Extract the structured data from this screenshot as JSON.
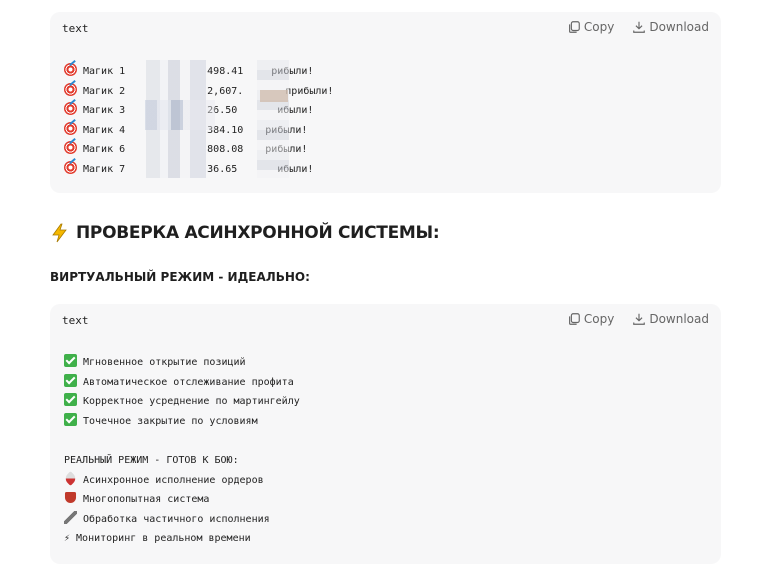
{
  "card1": {
    "lang": "text",
    "copy_label": "Copy",
    "download_label": "Download",
    "lines": [
      {
        "name": "Магик 1",
        "value": "498.41",
        "suffix": "рибыли!"
      },
      {
        "name": "Магик 2",
        "value": "2,607.",
        "suffix": "прибыли!"
      },
      {
        "name": "Магик 3",
        "value": "26.50",
        "suffix": "ибыли!"
      },
      {
        "name": "Магик 4",
        "value": "384.10",
        "suffix": "рибыли!"
      },
      {
        "name": "Магик 6",
        "value": "808.08",
        "suffix": "рибыли!"
      },
      {
        "name": "Магик 7",
        "value": "36.65",
        "suffix": "ибыли!"
      }
    ]
  },
  "heading": "ПРОВЕРКА АСИНХРОННОЙ СИСТЕМЫ:",
  "subheading": "ВИРТУАЛЬНЫЙ РЕЖИМ - ИДЕАЛЬНО:",
  "card2": {
    "lang": "text",
    "copy_label": "Copy",
    "download_label": "Download",
    "checks": [
      "Мгновенное открытие позиций",
      "Автоматическое отслеживание профита",
      "Корректное усреднение по мартингейлу",
      "Точечное закрытие по условиям"
    ],
    "real_title": "РЕАЛЬНЫЙ РЕЖИМ - ГОТОВ К БОЮ:",
    "real_items": [
      {
        "icon": "rocket-icon",
        "text": "Асинхронное исполнение ордеров"
      },
      {
        "icon": "shield-icon",
        "text": "Многопопытная система"
      },
      {
        "icon": "wrench-icon",
        "text": "Обработка частичного исполнения"
      },
      {
        "icon": "bolt-icon",
        "text": "⚡ Мониторинг в реальном времени"
      }
    ]
  }
}
